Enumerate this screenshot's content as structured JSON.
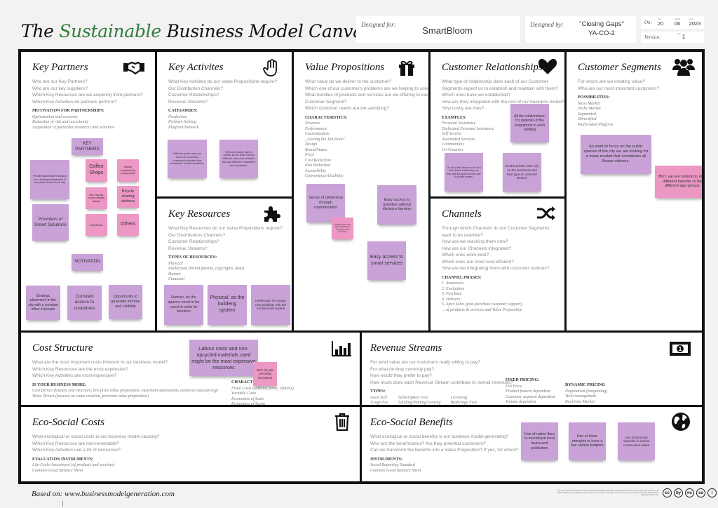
{
  "header": {
    "title_pre": "The ",
    "title_green": "Sustainable",
    "title_post": " Business Model Canvas",
    "designed_for_label": "Designed for:",
    "designed_for_value": "SmartBloom",
    "designed_by_label": "Designed by:",
    "designed_by_line1": "\"Closing Gaps\"",
    "designed_by_line2": "YA-CO-2",
    "on_label": "On:",
    "day_label": "Day",
    "month_label": "Month",
    "year_label": "Year",
    "day": "20",
    "month": "06",
    "year": "2023",
    "version_label": "Version:",
    "no_label": "No",
    "version": "1"
  },
  "colors": {
    "accent_green": "#2e7d3e",
    "note_purple": "#c9a2d8",
    "note_pink": "#ec97c4"
  },
  "key_partners": {
    "title": "Key Partners",
    "icon": "handshake-icon",
    "questions": [
      "Who are our Key Partners?",
      "Who are our key suppliers?",
      "Which Key Resources are we acquiring from partners?",
      "Which Key Activities do partners perform?"
    ],
    "sub": "Motivation for partnerships:",
    "items": [
      "Optimization and economy",
      "Reduction of risk and uncertainty",
      "Acquisition of particular resources and activities"
    ],
    "notes": [
      "KEY PARTNERS",
      "Private stakeholders looking for a strategic placement in the public areas of the city.",
      "Coffee Shops",
      "Startup companies by young people",
      "Cars, bicycles, robots charging stations",
      "Bicycle sharing stations",
      "Providers of Smart Solutions",
      "Cafeterias",
      "Others",
      "MOTIVATION",
      "Strategic placement in the city with a constant influx of people",
      "Constant access to customers",
      "Opportunity to generate income and visibility"
    ]
  },
  "key_activities": {
    "title": "Key Activites",
    "icon": "hand-icon",
    "questions": [
      "What Key Activites do our Value Propositions require?",
      "Our Distribution Channels?",
      "Customer Relationships?",
      "Revenue Streams?"
    ],
    "sub": "Categories:",
    "items": [
      "Production",
      "Problem Solving",
      "Platform/Network"
    ],
    "notes": [
      "With the public uses we focus on social and communal activities that incentivize social interaction.",
      "With the private uses it varies, as we hope having different uses and activities through different companies and bussiness."
    ]
  },
  "key_resources": {
    "title": "Key Resources",
    "icon": "puzzle-piece-icon",
    "questions": [
      "What Key Resources do our Value Propositions require?",
      "Our Distributions Channels?",
      "Customer Relationships?",
      "Revenue Streams?"
    ],
    "sub": "Types of resources:",
    "items": [
      "Physical",
      "Intellectual (brand patents, copyrights, data)",
      "Human",
      "Financial"
    ],
    "notes": [
      "Human, as the spaces need to be used in order to function",
      "Physical, as the buildeng system",
      "Intellectual, for design new buildings with the Architectural system"
    ]
  },
  "value_propositions": {
    "title": "Value Propositions",
    "icon": "gift-icon",
    "questions": [
      "What value do we deliver to the customer?",
      "Which one of our customer's problems are we helping to solve?",
      "What bundles of products and services are we offering to each",
      "Customer Segment?",
      "Which customer needs are we satisfying?"
    ],
    "sub": "Characteristics:",
    "items": [
      "Newness",
      "Performance",
      "Customization",
      "„Getting the Job Done\"",
      "Design",
      "Brand/Status",
      "Price",
      "Cost Reduction",
      "Risk Reduction",
      "Accessibility",
      "Convenience/Usability"
    ],
    "notes": [
      "Sense of ownership through customization",
      "Flexible spaces that adapt according to the needs of the community",
      "Easy access to activities without distance barriers",
      "Easy access to smart services"
    ]
  },
  "customer_relationships": {
    "title": "Customer Relationships",
    "icon": "heart-icon",
    "questions": [
      "What type of relationship does each of our Customer",
      "Segments expect us to establish and maintain with them?",
      "Which ones have we established?",
      "How are they integrated with the rest of our business model?",
      "How costly are they?"
    ],
    "sub": "Examples:",
    "items": [
      "Personal Assistance",
      "Dedicated Personal Assistance",
      "Self Service",
      "Automated Services",
      "Communities",
      "Co-Creation"
    ],
    "notes": [
      "All the relationships! It's depends of the programme in each building",
      "On the public uses is more of a self-service relationship, as they use the space as they see fit to their means.",
      "On the private uses rely on the bussiness and their type of customer service."
    ]
  },
  "channels": {
    "title": "Channels",
    "icon": "shuffle-icon",
    "questions": [
      "Through which Channels do our Customer Segments",
      "want to be reached?",
      "How are we reaching them now?",
      "How are our Channels integrated?",
      "Which ones work best?",
      "Which ones are most cost-efficient?",
      "How are we integrating them with customer routines?"
    ],
    "sub": "Channel phases:",
    "items": [
      "1. Awareness",
      "2. Evaluation",
      "3. Purchase",
      "4. Delivery",
      "5. After Sales (post-purchase customer support)",
      "... of products & services and Value Proposition"
    ]
  },
  "customer_segments": {
    "title": "Customer Segments",
    "icon": "group-icon",
    "questions": [
      "For whom are we creating value?",
      "Who are our most important customers?"
    ],
    "sub": "Possibilities:",
    "items": [
      "Mass Market",
      "Niche Market",
      "Segmented",
      "Diversified",
      "Multi-sided Platform"
    ],
    "notes": [
      "As want to focus on the public spaces of the city we are looking for a mass market that constitutes all Busan citizens.",
      "BUT, we are looking to offer different benefits to the different age groups."
    ]
  },
  "cost_structure": {
    "title": "Cost Structure",
    "icon": "bar-chart-icon",
    "questions": [
      "What are the most important costs inherent in our business model?",
      "Which Key Resources are the most expensive?",
      "Which Key Activities are most expensive?"
    ],
    "sub": "Is your business more:",
    "items": [
      "Cost Driven (leanest cost structure, low price value proposition, maximum automation, extensive outsourcing)",
      "Value Driven (focused on value creation, premium value proposition)"
    ],
    "sub2": "Characteristics:",
    "items2": [
      "Fixed Costs (salaries, rents, utilities)",
      "Variable Costs",
      "Economies of Scale",
      "Economies of Scope"
    ],
    "notes": [
      "Labour costs and non-upcycled materials used might be the most expensive resources",
      "BUT, it's just one initial investment"
    ]
  },
  "revenue_streams": {
    "title": "Revenue Streams",
    "icon": "banknote-icon",
    "questions": [
      "For what value are our customers really willing to pay?",
      "For what do they currently pay?",
      "How would they prefer to pay?",
      "How much does each Revenue Stream contribute to overall revenues?"
    ],
    "types_sub": "Types:",
    "types": [
      [
        "Asset Sale",
        "Usage Fee"
      ],
      [
        "Subscription Fees",
        "Lending/Renting/Leasing"
      ],
      [
        "Licensing",
        "Brokerage Fees"
      ]
    ],
    "fixed_sub": "Fixed pricing:",
    "fixed": [
      "List Price",
      "Product feature dependent",
      "Customer segment dependent",
      "Volume dependent"
    ],
    "dynamic_sub": "Dynamic pricing",
    "dynamic": [
      "Negotiation (bargaining)",
      "Yield management",
      "Real-time Market"
    ]
  },
  "eco_social_costs": {
    "title": "Eco-Social Costs",
    "icon": "trash-icon",
    "questions": [
      "What ecological or social costs is our business model causing?",
      "Which Key Resources are non-renewable?",
      "Which Key Activities use a lot of resources?"
    ],
    "sub": "Evaluation instruments:",
    "items": [
      "Life-Cycle Assessment (of products and services)",
      "Common Good Balance Sheet"
    ]
  },
  "eco_social_benefits": {
    "title": "Eco-Social Benefits",
    "icon": "globe-icon",
    "questions": [
      "What ecological or social benefits is our business model generating?",
      "Who are the beneficiaries? Are they potential customers?",
      "Can we transform the benefits into a Value Proposition? If yes, for whom?"
    ],
    "sub": "Instruments:",
    "items": [
      "Social Reporting Standard",
      "Common Good Balance Sheet"
    ],
    "notes": [
      "Use of native flora to incentivize local fauna and pollinators",
      "Use of clean energies to have a low carbon footprint",
      "Use of upcycled materials to reduce construction waste"
    ]
  },
  "footer": {
    "based_on": "Based on: www.businessmodelgeneration.com",
    "license": "This work is licensed under the Creative Commons Attribution-Share Alike 3.0 Unported License. To view a copy of this license, visit http://creativecommons.org/licenses/by-sa/3.0/ or send a letter to Creative Commons, 171 Second Street, Suite 300, San Francisco, California, 94105, USA.",
    "cc_icons": [
      "cc",
      "by",
      "nc",
      "sa",
      "i"
    ]
  }
}
